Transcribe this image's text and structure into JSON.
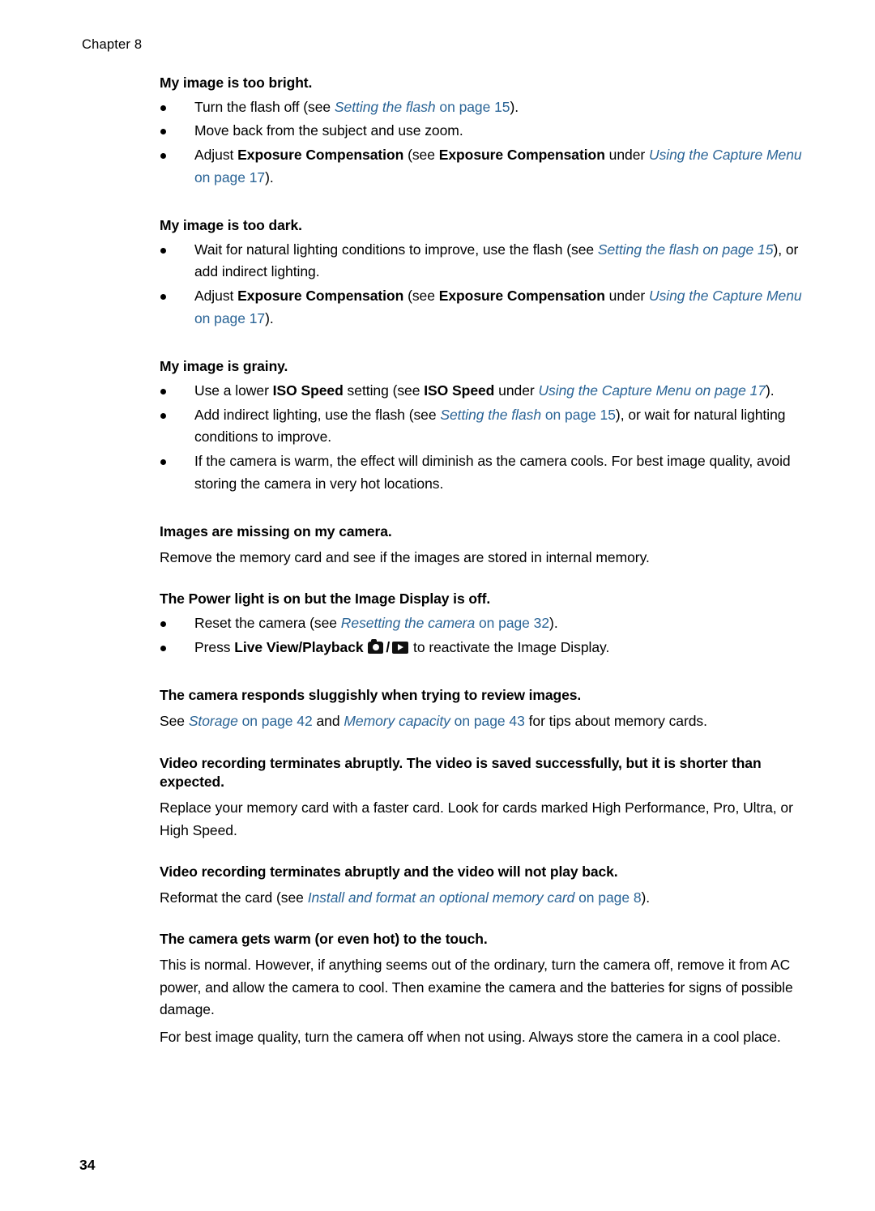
{
  "header": {
    "chapter": "Chapter 8"
  },
  "footer": {
    "page_number": "34"
  },
  "sections": [
    {
      "heading": "My image is too bright.",
      "bullets": [
        "Turn the flash off (see Setting the flash on page 15).",
        "Move back from the subject and use zoom.",
        "Adjust Exposure Compensation (see Exposure Compensation under Using the Capture Menu on page 17)."
      ]
    },
    {
      "heading": "My image is too dark.",
      "bullets": [
        "Wait for natural lighting conditions to improve, use the flash (see Setting the flash on page 15), or add indirect lighting.",
        "Adjust Exposure Compensation (see Exposure Compensation under Using the Capture Menu on page 17)."
      ]
    },
    {
      "heading": "My image is grainy.",
      "bullets": [
        "Use a lower ISO Speed setting (see ISO Speed under Using the Capture Menu on page 17).",
        "Add indirect lighting, use the flash (see Setting the flash on page 15), or wait for natural lighting conditions to improve.",
        "If the camera is warm, the effect will diminish as the camera cools. For best image quality, avoid storing the camera in very hot locations."
      ]
    },
    {
      "heading": "Images are missing on my camera.",
      "paragraph": "Remove the memory card and see if the images are stored in internal memory."
    },
    {
      "heading": "The Power light is on but the Image Display is off.",
      "bullets": [
        "Reset the camera (see Resetting the camera on page 32).",
        "Press Live View/Playback  /  to reactivate the Image Display."
      ]
    },
    {
      "heading": "The camera responds sluggishly when trying to review images.",
      "paragraph": "See Storage on page 42 and Memory capacity on page 43 for tips about memory cards."
    },
    {
      "heading": "Video recording terminates abruptly. The video is saved successfully, but it is shorter than expected.",
      "paragraph": "Replace your memory card with a faster card. Look for cards marked High Performance, Pro, Ultra, or High Speed."
    },
    {
      "heading": "Video recording terminates abruptly and the video will not play back.",
      "paragraph": "Reformat the card (see Install and format an optional memory card on page 8)."
    },
    {
      "heading": "The camera gets warm (or even hot) to the touch.",
      "paragraph": "This is normal. However, if anything seems out of the ordinary, turn the camera off, remove it from AC power, and allow the camera to cool. Then examine the camera and the batteries for signs of possible damage.",
      "paragraph2": "For best image quality, turn the camera off when not using. Always store the camera in a cool place."
    }
  ],
  "text_fragments": {
    "s1_b1_a": "Turn the flash off (see ",
    "s1_b1_link": "Setting the flash",
    "s1_b1_b": " on page 15",
    "s1_b1_c": ").",
    "s1_b2": "Move back from the subject and use zoom.",
    "s1_b3_a": "Adjust ",
    "s1_b3_bold1": "Exposure Compensation",
    "s1_b3_b": " (see ",
    "s1_b3_bold2": "Exposure Compensation",
    "s1_b3_c": " under ",
    "s1_b3_link": "Using the Capture Menu",
    "s1_b3_d": " on page 17",
    "s1_b3_e": ").",
    "s2_b1_a": "Wait for natural lighting conditions to improve, use the flash (see ",
    "s2_b1_link": "Setting the flash on page 15",
    "s2_b1_b": "), or add indirect lighting.",
    "s2_b2_a": "Adjust ",
    "s2_b2_bold1": "Exposure Compensation",
    "s2_b2_b": " (see ",
    "s2_b2_bold2": "Exposure Compensation",
    "s2_b2_c": " under ",
    "s2_b2_link": "Using the Capture Menu",
    "s2_b2_d": " on page 17",
    "s2_b2_e": ").",
    "s3_b1_a": "Use a lower ",
    "s3_b1_bold1": "ISO Speed",
    "s3_b1_b": " setting (see ",
    "s3_b1_bold2": "ISO Speed",
    "s3_b1_c": " under ",
    "s3_b1_link": "Using the Capture Menu on page 17",
    "s3_b1_d": ").",
    "s3_b2_a": "Add indirect lighting, use the flash (see ",
    "s3_b2_link": "Setting the flash",
    "s3_b2_b": " on page 15",
    "s3_b2_c": "), or wait for natural lighting conditions to improve.",
    "s3_b3": "If the camera is warm, the effect will diminish as the camera cools. For best image quality, avoid storing the camera in very hot locations.",
    "s4_p": "Remove the memory card and see if the images are stored in internal memory.",
    "s5_b1_a": "Reset the camera (see ",
    "s5_b1_link": "Resetting the camera",
    "s5_b1_b": " on page 32",
    "s5_b1_c": ").",
    "s5_b2_a": "Press ",
    "s5_b2_bold": "Live View/Playback",
    "s5_b2_b": " to reactivate the Image Display.",
    "s6_p_a": "See ",
    "s6_p_link1": "Storage",
    "s6_p_b": " on page 42",
    "s6_p_c": " and ",
    "s6_p_link2": "Memory capacity",
    "s6_p_d": " on page 43",
    "s6_p_e": " for tips about memory cards.",
    "s7_p": "Replace your memory card with a faster card. Look for cards marked High Performance, Pro, Ultra, or High Speed.",
    "s8_p_a": "Reformat the card (see ",
    "s8_p_link": "Install and format an optional memory card",
    "s8_p_b": " on page 8",
    "s8_p_c": ").",
    "s9_p1": "This is normal. However, if anything seems out of the ordinary, turn the camera off, remove it from AC power, and allow the camera to cool. Then examine the camera and the batteries for signs of possible damage.",
    "s9_p2": "For best image quality, turn the camera off when not using. Always store the camera in a cool place."
  },
  "colors": {
    "link": "#2a6496",
    "text": "#000000",
    "background": "#ffffff"
  }
}
